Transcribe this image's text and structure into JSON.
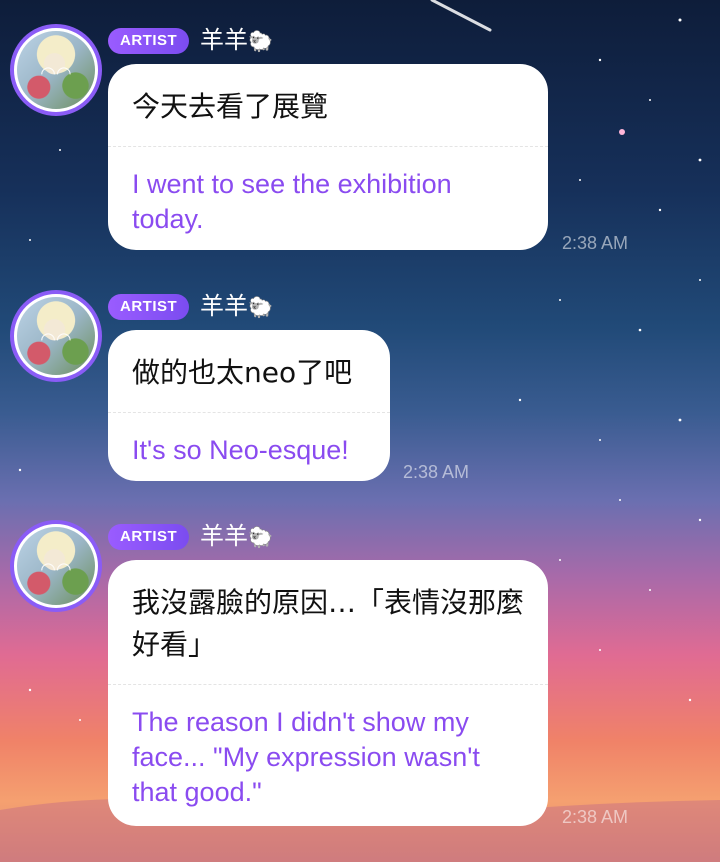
{
  "messages": [
    {
      "badge": "ARTIST",
      "sender": "羊羊",
      "sender_icon": "sheep-emoji",
      "original": "今天去看了展覽",
      "translation": "I went to see the exhibition today.",
      "time": "2:38 AM"
    },
    {
      "badge": "ARTIST",
      "sender": "羊羊",
      "sender_icon": "sheep-emoji",
      "original": "做的也太neo了吧",
      "translation": "It's so Neo-esque!",
      "time": "2:38 AM"
    },
    {
      "badge": "ARTIST",
      "sender": "羊羊",
      "sender_icon": "sheep-emoji",
      "original": "我沒露臉的原因…「表情沒那麼好看」",
      "translation": "The reason I didn't show my face... \"My expression wasn't that good.\"",
      "time": "2:38 AM"
    }
  ],
  "colors": {
    "badge": "#8a5cf6",
    "translation_text": "#8a4bf0",
    "bubble": "#ffffff"
  }
}
